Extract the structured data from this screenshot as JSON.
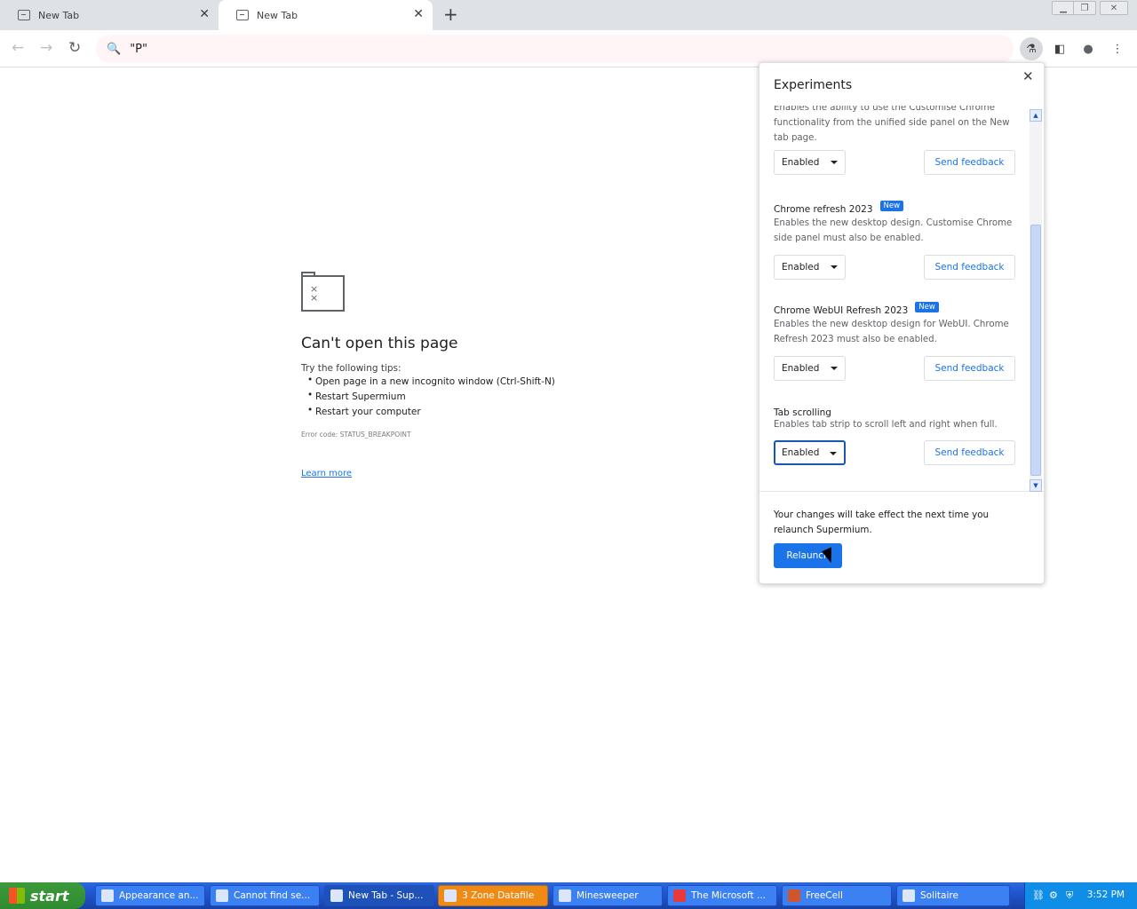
{
  "tabs": [
    {
      "title": "New Tab"
    },
    {
      "title": "New Tab"
    }
  ],
  "toolbar": {
    "omnibox_value": "\"P\""
  },
  "error_page": {
    "title": "Can't open this page",
    "tips_heading": "Try the following tips:",
    "tips": [
      "Open page in a new incognito window (Ctrl-Shift-N)",
      "Restart Supermium",
      "Restart your computer"
    ],
    "error_code": "Error code: STATUS_BREAKPOINT",
    "learn_more": "Learn more"
  },
  "experiments": {
    "title": "Experiments",
    "flags": [
      {
        "name": "",
        "desc": "Enables the ability to use the Customise Chrome functionality from the unified side panel on the New tab page.",
        "value": "Enabled",
        "feedback": "Send feedback"
      },
      {
        "name": "Chrome refresh 2023",
        "badge": "New",
        "desc": "Enables the new desktop design. Customise Chrome side panel must also be enabled.",
        "value": "Enabled",
        "feedback": "Send feedback"
      },
      {
        "name": "Chrome WebUI Refresh 2023",
        "badge": "New",
        "desc": "Enables the new desktop design for WebUI. Chrome Refresh 2023 must also be enabled.",
        "value": "Enabled",
        "feedback": "Send feedback"
      },
      {
        "name": "Tab scrolling",
        "desc": "Enables tab strip to scroll left and right when full.",
        "value": "Enabled",
        "feedback": "Send feedback"
      }
    ],
    "footer_message": "Your changes will take effect the next time you relaunch Supermium.",
    "relaunch_label": "Relaunch"
  },
  "taskbar": {
    "start_label": "start",
    "tasks": [
      "Appearance an...",
      "Cannot find se...",
      "New Tab - Sup...",
      "3 Zone Datafile",
      "Minesweeper",
      "The Microsoft ...",
      "FreeCell",
      "Solitaire"
    ],
    "clock": "3:52 PM"
  }
}
